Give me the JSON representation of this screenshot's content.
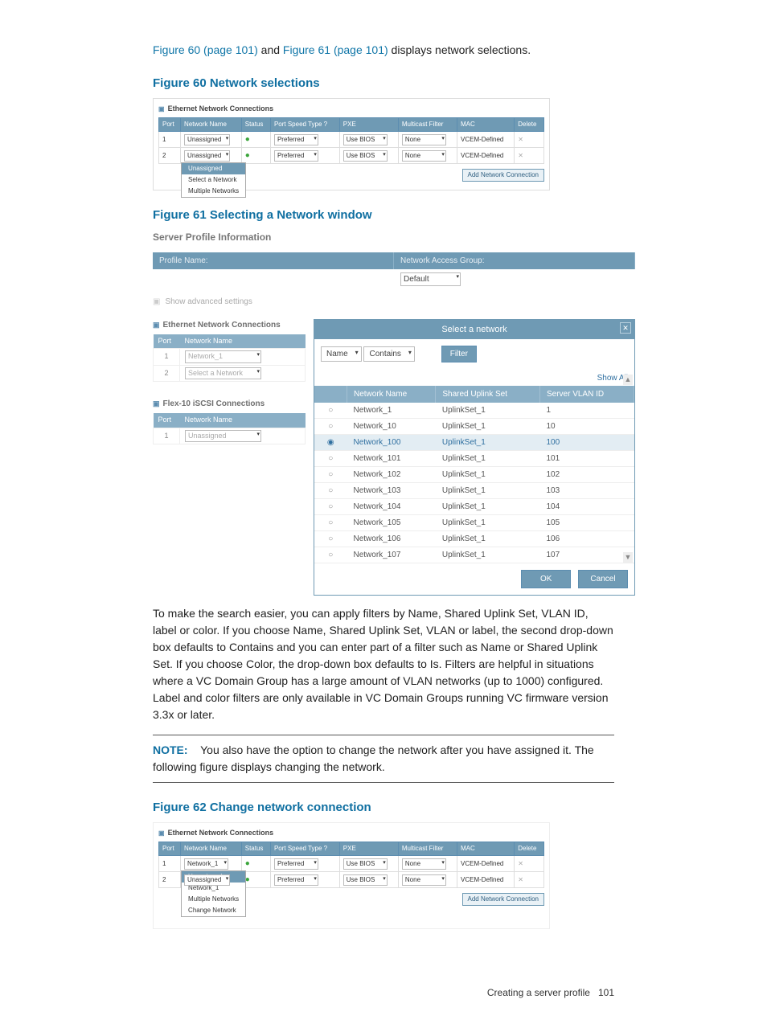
{
  "intro": {
    "link1": "Figure 60 (page 101)",
    "mid": " and ",
    "link2": "Figure 61 (page 101)",
    "tail": " displays network selections."
  },
  "fig60": {
    "title": "Figure 60 Network selections",
    "panel_title": "Ethernet Network Connections",
    "headers": [
      "Port",
      "Network Name",
      "Status",
      "Port Speed Type ?",
      "PXE",
      "Multicast Filter",
      "MAC",
      "Delete"
    ],
    "rows": [
      {
        "port": "1",
        "name": "Unassigned",
        "status": "ok",
        "speed": "Preferred",
        "pxe": "Use BIOS",
        "filter": "None",
        "mac": "VCEM-Defined"
      },
      {
        "port": "2",
        "name": "Unassigned",
        "status": "ok",
        "speed": "Preferred",
        "pxe": "Use BIOS",
        "filter": "None",
        "mac": "VCEM-Defined"
      }
    ],
    "dropdown_open": {
      "options": [
        "Unassigned",
        "Select a Network",
        "Multiple Networks"
      ],
      "highlighted": "Unassigned"
    },
    "add_btn": "Add Network Connection"
  },
  "fig61": {
    "title": "Figure 61 Selecting a Network window",
    "spi": "Server Profile Information",
    "hdr_left": "Profile Name:",
    "hdr_right": "Network Access Group:",
    "nag_value": "Default",
    "adv": "Show advanced settings",
    "enc_title": "Ethernet Network Connections",
    "enc_headers": [
      "Port",
      "Network Name"
    ],
    "enc_rows": [
      {
        "port": "1",
        "name": "Network_1"
      },
      {
        "port": "2",
        "name": "Select a Network"
      }
    ],
    "iscsi_title": "Flex-10 iSCSI Connections",
    "iscsi_headers": [
      "Port",
      "Network Name"
    ],
    "iscsi_rows": [
      {
        "port": "1",
        "name": "Unassigned"
      }
    ],
    "sel_title": "Select a network",
    "filter_left": "Name",
    "filter_op": "Contains",
    "filter_btn": "Filter",
    "show_all": "Show All",
    "net_headers": [
      "Network Name",
      "Shared Uplink Set",
      "Server VLAN ID"
    ],
    "net_rows": [
      {
        "name": "Network_1",
        "sus": "UplinkSet_1",
        "vlan": "1",
        "sel": false
      },
      {
        "name": "Network_10",
        "sus": "UplinkSet_1",
        "vlan": "10",
        "sel": false
      },
      {
        "name": "Network_100",
        "sus": "UplinkSet_1",
        "vlan": "100",
        "sel": true
      },
      {
        "name": "Network_101",
        "sus": "UplinkSet_1",
        "vlan": "101",
        "sel": false
      },
      {
        "name": "Network_102",
        "sus": "UplinkSet_1",
        "vlan": "102",
        "sel": false
      },
      {
        "name": "Network_103",
        "sus": "UplinkSet_1",
        "vlan": "103",
        "sel": false
      },
      {
        "name": "Network_104",
        "sus": "UplinkSet_1",
        "vlan": "104",
        "sel": false
      },
      {
        "name": "Network_105",
        "sus": "UplinkSet_1",
        "vlan": "105",
        "sel": false
      },
      {
        "name": "Network_106",
        "sus": "UplinkSet_1",
        "vlan": "106",
        "sel": false
      },
      {
        "name": "Network_107",
        "sus": "UplinkSet_1",
        "vlan": "107",
        "sel": false
      }
    ],
    "ok": "OK",
    "cancel": "Cancel"
  },
  "body_para": "To make the search easier, you can apply filters by Name, Shared Uplink Set, VLAN ID, label or color. If you choose Name, Shared Uplink Set, VLAN or label, the second drop-down box defaults to Contains and you can enter part of a filter such as Name or Shared Uplink Set. If you choose Color, the drop-down box defaults to Is. Filters are helpful in situations where a VC Domain Group has a large amount of VLAN networks (up to 1000) configured. Label and color filters are only available in VC Domain Groups running VC firmware version 3.3x or later.",
  "note": {
    "label": "NOTE:",
    "text": "You also have the option to change the network after you have assigned it. The following figure displays changing the network."
  },
  "fig62": {
    "title": "Figure 62 Change network connection",
    "panel_title": "Ethernet Network Connections",
    "headers": [
      "Port",
      "Network Name",
      "Status",
      "Port Speed Type ?",
      "PXE",
      "Multicast Filter",
      "MAC",
      "Delete"
    ],
    "rows": [
      {
        "port": "1",
        "name": "Network_1",
        "status": "ok",
        "speed": "Preferred",
        "pxe": "Use BIOS",
        "filter": "None",
        "mac": "VCEM-Defined"
      },
      {
        "port": "2",
        "name": "Unassigned",
        "status": "ok",
        "speed": "Preferred",
        "pxe": "Use BIOS",
        "filter": "None",
        "mac": "VCEM-Defined"
      }
    ],
    "dropdown_open": {
      "options": [
        "Unassigned",
        "Network_1",
        "Multiple Networks",
        "Change Network"
      ],
      "highlighted": "Unassigned"
    },
    "add_btn": "Add Network Connection"
  },
  "footer": {
    "section": "Creating a server profile",
    "page": "101"
  }
}
